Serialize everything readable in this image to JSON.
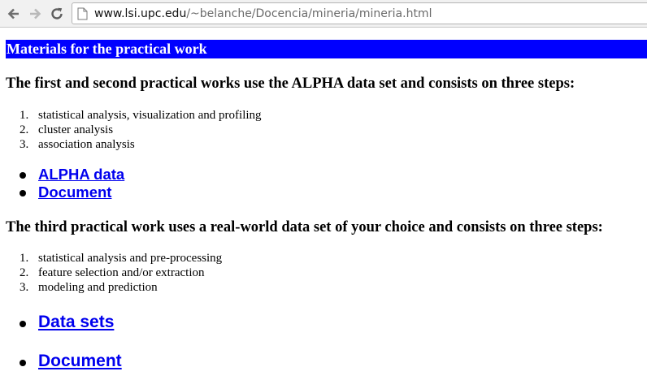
{
  "browser": {
    "url_host": "www.lsi.upc.edu",
    "url_path": "/~belanche/Docencia/mineria/mineria.html"
  },
  "page": {
    "section_title": "Materials for the practical work",
    "part1": {
      "heading": "The first and second practical works use the ALPHA data set and consists on three steps:",
      "steps": [
        {
          "num": "1.",
          "text": "statistical analysis, visualization and profiling"
        },
        {
          "num": "2.",
          "text": "cluster analysis"
        },
        {
          "num": "3.",
          "text": "association analysis"
        }
      ],
      "links": [
        "ALPHA data",
        "Document"
      ]
    },
    "part2": {
      "heading": "The third practical work uses a real-world data set of your choice and consists on three steps:",
      "steps": [
        {
          "num": "1.",
          "text": "statistical analysis and pre-processing"
        },
        {
          "num": "2.",
          "text": "feature selection and/or extraction"
        },
        {
          "num": "3.",
          "text": "modeling and prediction"
        }
      ],
      "links": [
        "Data sets",
        "Document"
      ]
    }
  },
  "colors": {
    "section_bar": "#0000ff",
    "link": "#0000ee"
  },
  "icons": {
    "back": "back-arrow-icon",
    "forward": "forward-arrow-icon",
    "reload": "reload-icon",
    "page": "page-icon"
  }
}
